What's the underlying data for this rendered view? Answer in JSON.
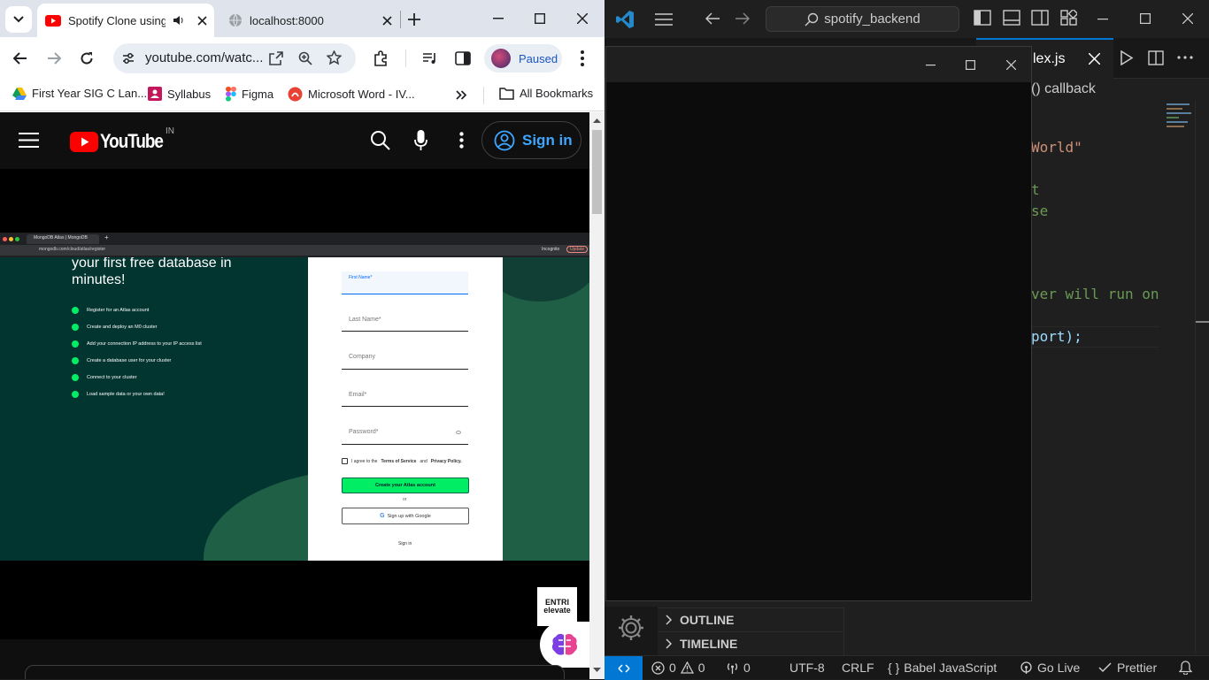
{
  "browser": {
    "tabs": [
      {
        "title": "Spotify Clone using"
      },
      {
        "title": "localhost:8000"
      }
    ],
    "url": "youtube.com/watc...",
    "profile_status": "Paused",
    "bookmarks": [
      "First Year SIG C Lan...",
      "Syllabus",
      "Figma",
      "Microsoft Word - IV..."
    ],
    "all_bookmarks": "All Bookmarks"
  },
  "youtube": {
    "logo_text": "YouTube",
    "region": "IN",
    "sign_in": "Sign in",
    "watermark": "ENTRI elevate"
  },
  "video": {
    "browser_tab": "MongoDB Atlas | MongoDB",
    "url": "mongodb.com/cloud/atlas/register",
    "incognito": "Incognito",
    "update": "Update",
    "headline": "your first free database in minutes!",
    "steps": [
      "Register for an Atlas account",
      "Create and deploy an M0 cluster",
      "Add your connection IP address to your IP access list",
      "Create a database user for your cluster",
      "Connect to your cluster",
      "Load sample data or your own data!"
    ],
    "fields": [
      "First Name*",
      "Last Name*",
      "Company",
      "Email*",
      "Password*"
    ],
    "agree_prefix": "I agree to the",
    "terms": "Terms of Service",
    "and": "and",
    "privacy": "Privacy Policy.",
    "create_btn": "Create your Atlas account",
    "or": "or",
    "google_btn": "Sign up with Google",
    "sign_in": "Sign in"
  },
  "vscode": {
    "search": "spotify_backend",
    "tab_name": "lex.js",
    "breadcrumb": "() callback",
    "code_lines": [
      {
        "text": "World\"",
        "color": "#ce9178"
      },
      {
        "text": "t",
        "color": "#6a9955"
      },
      {
        "text": "se",
        "color": "#6a9955"
      },
      {
        "text": "ver will run on",
        "color": "#6a9955"
      },
      {
        "text": "port);",
        "color": "#9cdcfe"
      }
    ],
    "outline": "OUTLINE",
    "timeline": "TIMELINE",
    "status": {
      "errors": "0",
      "warnings": "0",
      "ports": "0",
      "encoding": "UTF-8",
      "eol": "CRLF",
      "language": "Babel JavaScript",
      "golive": "Go Live",
      "prettier": "Prettier"
    }
  }
}
